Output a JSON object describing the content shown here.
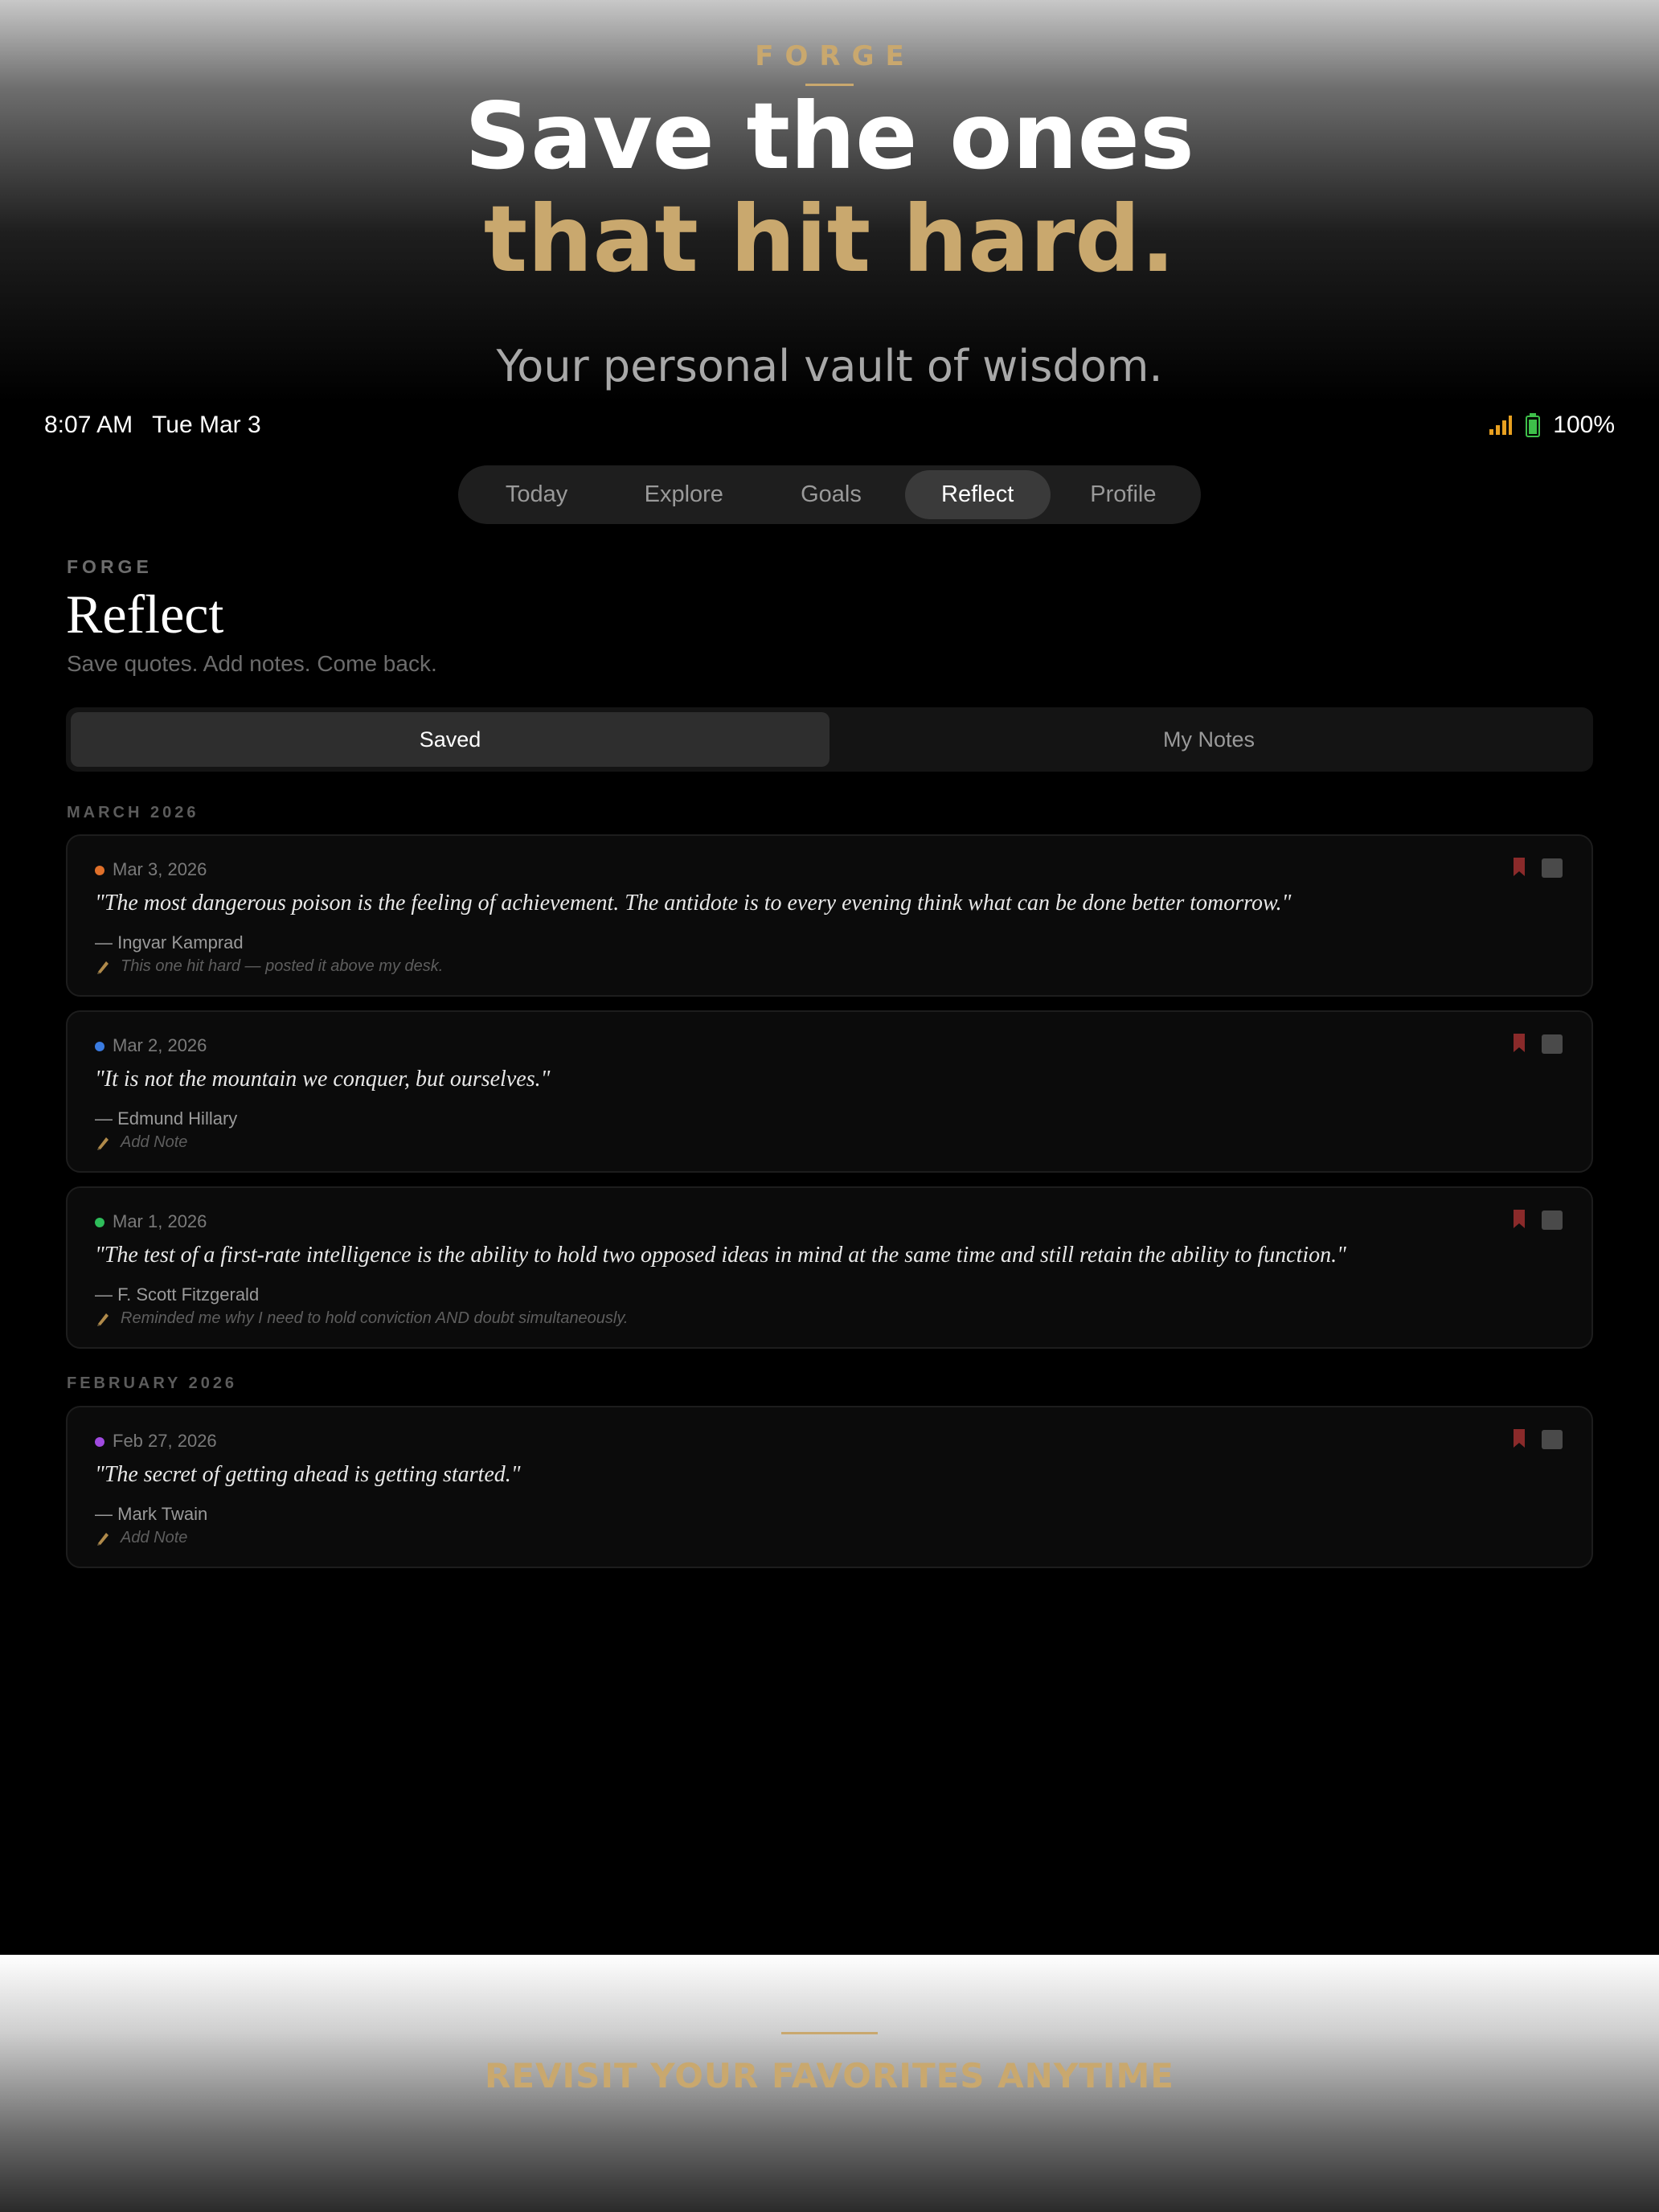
{
  "promo": {
    "brand": "FORGE",
    "headline_line1": "Save the ones",
    "headline_line2": "that hit hard.",
    "subtitle": "Your personal vault of wisdom.",
    "bottom_tagline": "REVISIT YOUR FAVORITES ANYTIME"
  },
  "status_bar": {
    "time": "8:07 AM",
    "date": "Tue Mar 3",
    "battery": "100%",
    "wifi_icon": "wifi-icon",
    "battery_icon": "battery-icon"
  },
  "nav": {
    "tabs": [
      {
        "label": "Today"
      },
      {
        "label": "Explore"
      },
      {
        "label": "Goals"
      },
      {
        "label": "Reflect"
      },
      {
        "label": "Profile"
      }
    ],
    "active": "Reflect"
  },
  "header": {
    "brand": "FORGE",
    "title": "Reflect",
    "subtitle": "Save quotes. Add notes. Come back."
  },
  "segments": {
    "saved": "Saved",
    "my_notes": "My Notes",
    "active": "Saved"
  },
  "months": [
    {
      "label": "MARCH 2026"
    },
    {
      "label": "FEBRUARY 2026"
    }
  ],
  "cards": [
    {
      "date": "Mar 3, 2026",
      "dot_color": "#e0702a",
      "quote": "\"The most dangerous poison is the feeling of achievement. The antidote is to every evening think what can be done better tomorrow.\"",
      "author": "— Ingvar Kamprad",
      "note": "This one hit hard — posted it above my desk."
    },
    {
      "date": "Mar 2, 2026",
      "dot_color": "#3a7be0",
      "quote": "\"It is not the mountain we conquer, but ourselves.\"",
      "author": "— Edmund Hillary",
      "note": "Add Note"
    },
    {
      "date": "Mar 1, 2026",
      "dot_color": "#2ebd5a",
      "quote": "\"The test of a first-rate intelligence is the ability to hold two opposed ideas in mind at the same time and still retain the ability to function.\"",
      "author": "— F. Scott Fitzgerald",
      "note": "Reminded me why I need to hold conviction AND doubt simultaneously."
    },
    {
      "date": "Feb 27, 2026",
      "dot_color": "#a04ae0",
      "quote": "\"The secret of getting ahead is getting started.\"",
      "author": "— Mark Twain",
      "note": "Add Note"
    }
  ],
  "colors": {
    "accent_gold": "#c9a86e",
    "bookmark_red": "#8a2a2a",
    "background": "#000000"
  }
}
